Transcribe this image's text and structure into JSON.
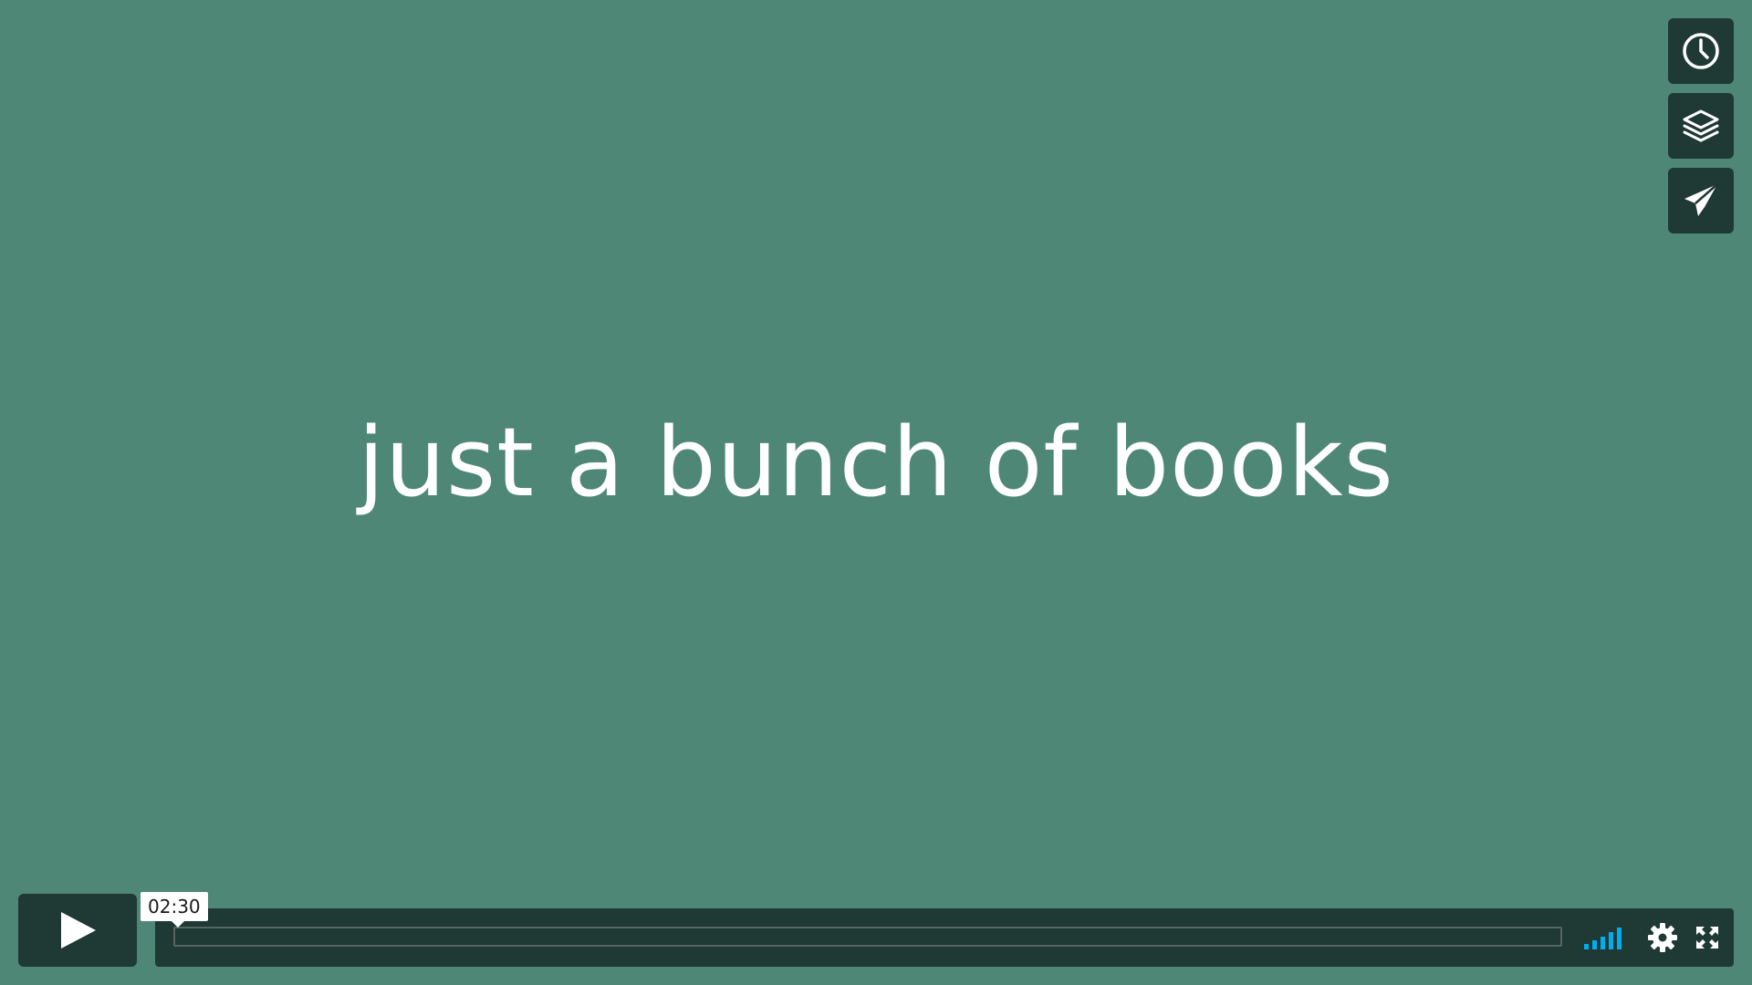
{
  "video": {
    "caption": "just a bunch of books",
    "background_color": "#4e8776"
  },
  "side_actions": [
    {
      "name": "watch-later",
      "icon": "clock-icon"
    },
    {
      "name": "collections",
      "icon": "layers-icon"
    },
    {
      "name": "share",
      "icon": "paper-plane-icon"
    }
  ],
  "controls": {
    "play_icon": "play-icon",
    "time_tooltip": "02:30",
    "progress_fraction": 0.0,
    "volume_icon": "volume-bars-icon",
    "volume_color": "#00adef",
    "settings_icon": "gear-icon",
    "fullscreen_icon": "fullscreen-icon"
  }
}
